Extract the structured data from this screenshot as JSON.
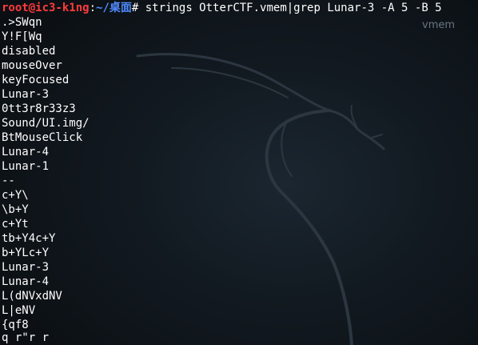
{
  "desktop": {
    "file_label": "vmem"
  },
  "terminal": {
    "prompt": {
      "user_host": "root@ic3-k1ng",
      "separator": ":",
      "path": "~/桌面",
      "hash": "#",
      "command": " strings OtterCTF.vmem|grep Lunar-3 -A 5 -B 5"
    },
    "output": [
      ".>SWqn",
      "Y!F[Wq",
      "disabled",
      "mouseOver",
      "keyFocused",
      "Lunar-3",
      "0tt3r8r33z3",
      "Sound/UI.img/",
      "BtMouseClick",
      "Lunar-4",
      "Lunar-1",
      "--",
      "c+Y\\",
      "\\b+Y",
      "c+Yt",
      "tb+Y4c+Y",
      "b+YLc+Y",
      "Lunar-3",
      "Lunar-4",
      "L(dNVxdNV",
      "L|eNV",
      "{qf8",
      "q r\"r r"
    ]
  }
}
